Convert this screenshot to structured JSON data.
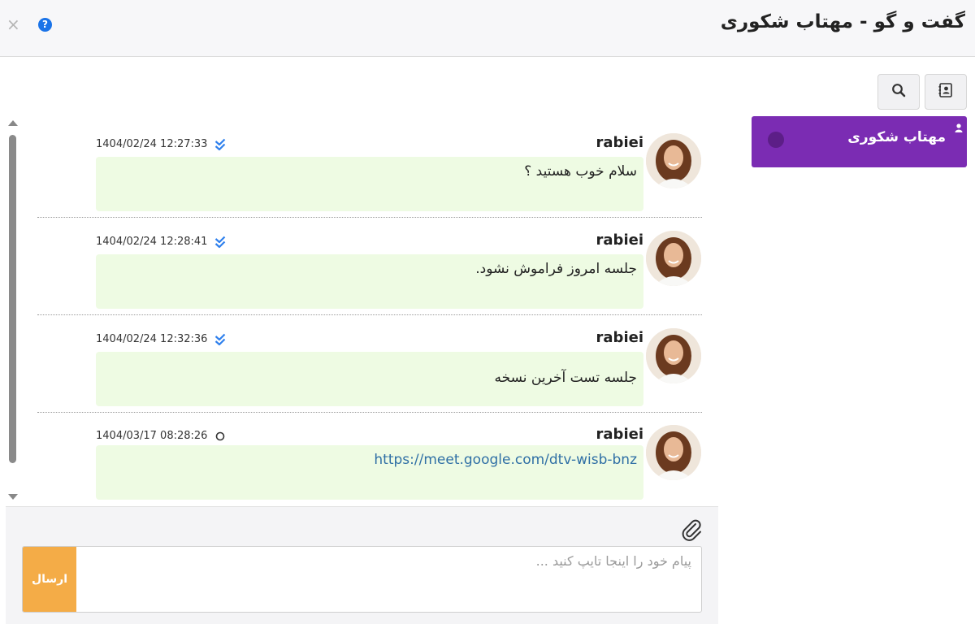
{
  "header": {
    "title": "گفت و گو - مهتاب شکوری",
    "close_glyph": "×",
    "help_glyph": "?"
  },
  "sidebar": {
    "tools": [
      {
        "icon": "contacts-icon"
      },
      {
        "icon": "search-icon"
      }
    ],
    "contacts": [
      {
        "name": "مهتاب شکوری",
        "selected": true,
        "color": "#7b2cb3"
      }
    ]
  },
  "messages": [
    {
      "sender": "rabiei",
      "time": "1404/02/24 12:27:33",
      "status": "read",
      "text": "سلام خوب هستید ؟"
    },
    {
      "sender": "rabiei",
      "time": "1404/02/24 12:28:41",
      "status": "read",
      "text": "جلسه امروز فراموش نشود."
    },
    {
      "sender": "rabiei",
      "time": "1404/02/24 12:32:36",
      "status": "read",
      "text": "جلسه تست آخرین نسخه"
    },
    {
      "sender": "rabiei",
      "time": "1404/03/17 08:28:26",
      "status": "pending",
      "link": "https://meet.google.com/dtv-wisb-bnz"
    }
  ],
  "composer": {
    "placeholder": "پیام خود را اینجا تایپ کنید ...",
    "value": "",
    "send_label": "ارسال"
  },
  "colors": {
    "accent": "#7b2cb3",
    "send": "#f4ac47",
    "bubble": "#eefbe3",
    "read_check": "#2f80ed"
  }
}
